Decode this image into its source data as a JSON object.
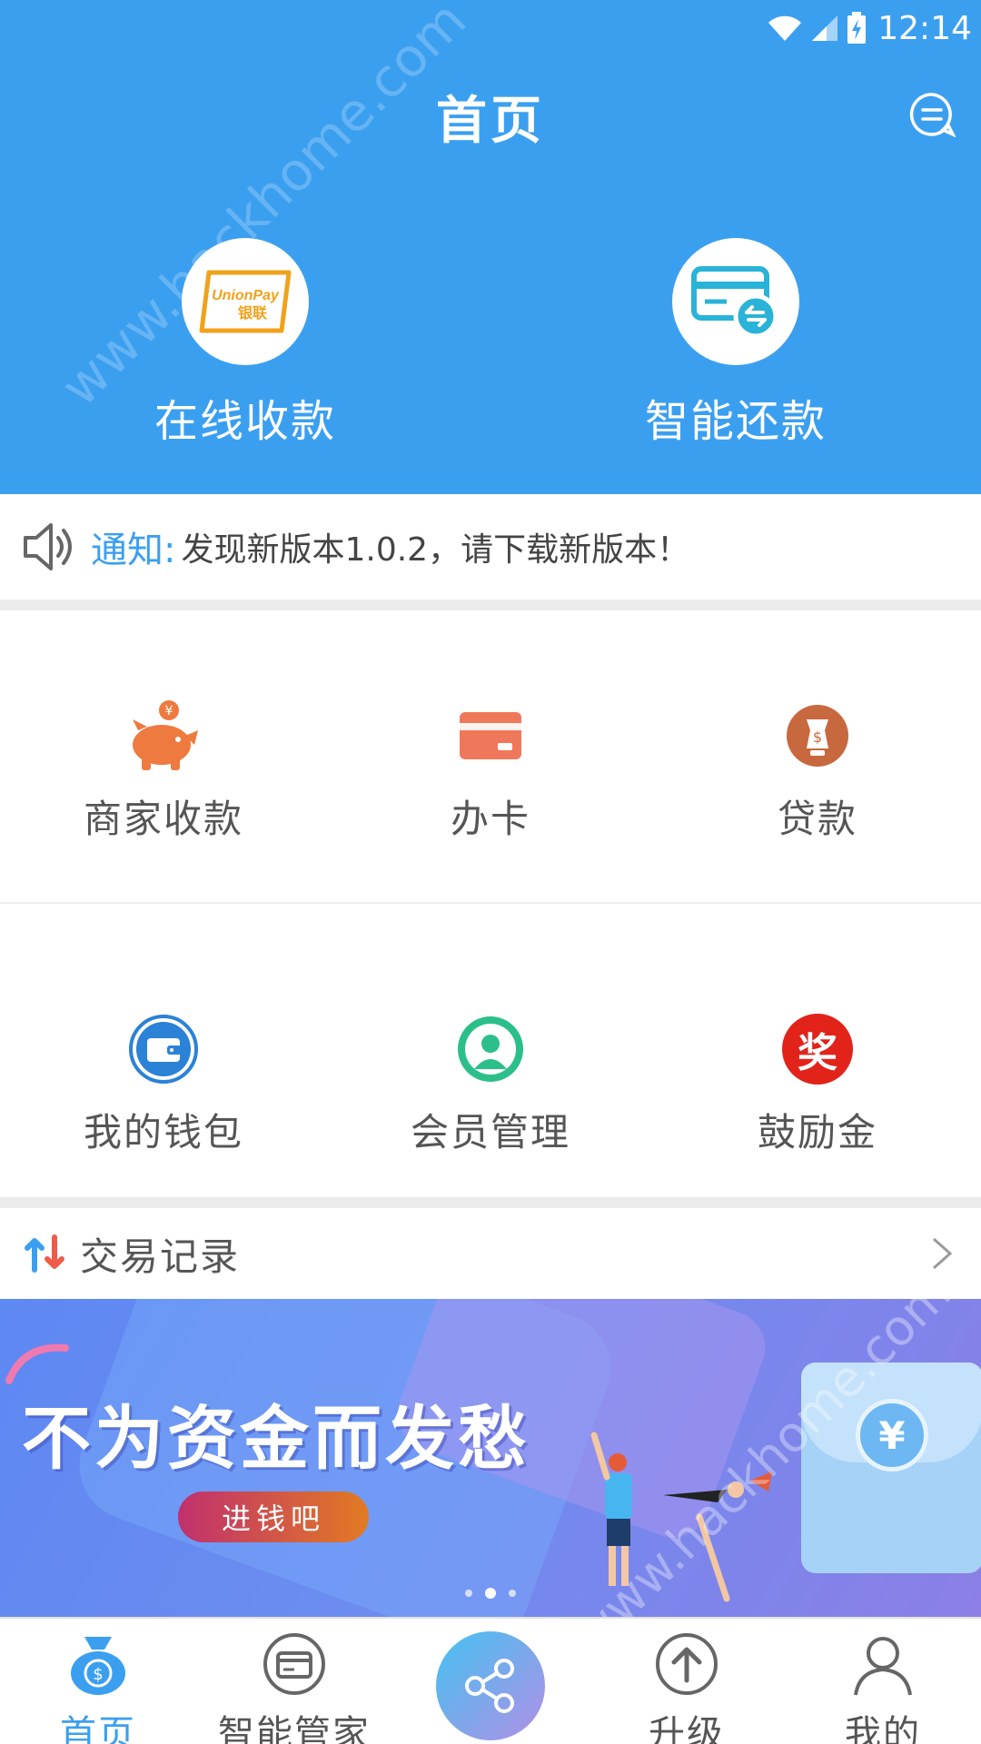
{
  "status_bar": {
    "time": "12:14",
    "icons": [
      "wifi-icon",
      "signal-icon",
      "battery-charging-icon"
    ]
  },
  "header": {
    "title": "首页",
    "quick_actions": [
      {
        "label": "在线收款",
        "icon": "unionpay-icon",
        "logo_text": "UnionPay",
        "logo_subtext": "银联"
      },
      {
        "label": "智能还款",
        "icon": "card-repay-icon"
      }
    ]
  },
  "watermark": "www.hackhome.com",
  "notice": {
    "label": "通知:",
    "text": "发现新版本1.0.2，请下载新版本！"
  },
  "grid": {
    "row1": [
      {
        "label": "商家收款",
        "icon": "piggy-bank-icon"
      },
      {
        "label": "办卡",
        "icon": "card-icon"
      },
      {
        "label": "贷款",
        "icon": "loan-icon"
      }
    ],
    "row2": [
      {
        "label": "我的钱包",
        "icon": "wallet-icon"
      },
      {
        "label": "会员管理",
        "icon": "member-icon"
      },
      {
        "label": "鼓励金",
        "icon": "reward-icon",
        "badge": "奖"
      }
    ]
  },
  "transactions": {
    "label": "交易记录"
  },
  "banner": {
    "title": "不为资金而发愁",
    "button": "进钱吧",
    "coin": "¥",
    "pages": 3,
    "active_page": 2
  },
  "bottom_nav": [
    {
      "label": "首页",
      "icon": "home-money-icon",
      "active": true
    },
    {
      "label": "智能管家",
      "icon": "card-manager-icon",
      "active": false
    },
    {
      "label": "",
      "icon": "share-icon",
      "active": false
    },
    {
      "label": "升级",
      "icon": "upgrade-icon",
      "active": false
    },
    {
      "label": "我的",
      "icon": "user-icon",
      "active": false
    }
  ],
  "colors": {
    "primary": "#3b9ff0",
    "piggy": "#ee7a3f",
    "card": "#f0785a",
    "loan": "#c8683e",
    "wallet": "#2b82d6",
    "member": "#2bbf8a",
    "reward": "#e2231a"
  }
}
